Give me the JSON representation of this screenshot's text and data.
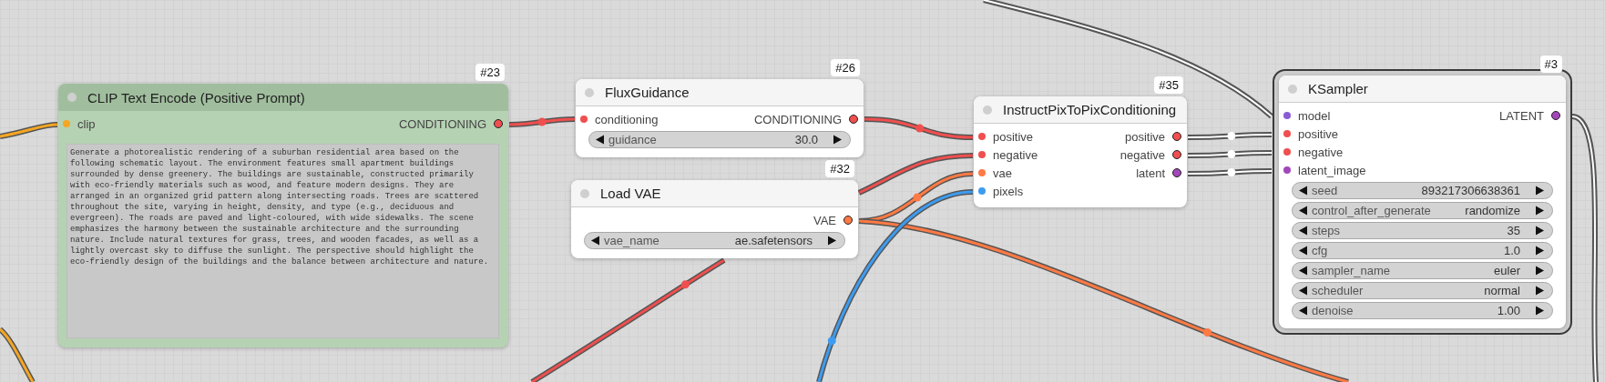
{
  "nodes": [
    {
      "badge": "#23",
      "title": "CLIP Text Encode (Positive Prompt)",
      "color": "#b5d2b3",
      "selected": false,
      "inputs": [
        {
          "label": "clip",
          "color": "#f5a623"
        }
      ],
      "outputs": [
        {
          "label": "CONDITIONING",
          "color": "#ef4f4f"
        }
      ],
      "widgets": [
        {
          "kind": "text",
          "value": "Generate a photorealistic rendering of a suburban residential area based on the following schematic layout. The environment features small apartment buildings surrounded by dense greenery. The buildings are sustainable, constructed primarily with eco-friendly materials such as wood, and feature modern designs. They are arranged in an organized grid pattern along intersecting roads. Trees are scattered throughout the site, varying in height, density, and type (e.g., deciduous and evergreen). The roads are paved and light-coloured, with wide sidewalks. The scene emphasizes the harmony between the sustainable architecture and the surrounding nature. Include natural textures for grass, trees, and wooden facades, as well as a lightly overcast sky to diffuse the sunlight. The perspective should highlight the eco-friendly design of the buildings and the balance between architecture and nature."
        }
      ]
    },
    {
      "badge": "#26",
      "title": "FluxGuidance",
      "selected": false,
      "inputs": [
        {
          "label": "conditioning",
          "color": "#ef4f4f"
        }
      ],
      "outputs": [
        {
          "label": "CONDITIONING",
          "color": "#ef4f4f"
        }
      ],
      "widgets": [
        {
          "kind": "number",
          "label": "guidance",
          "value": "30.0"
        }
      ]
    },
    {
      "badge": "#32",
      "title": "Load VAE",
      "selected": false,
      "outputs": [
        {
          "label": "VAE",
          "color": "#ff7a45"
        }
      ],
      "widgets": [
        {
          "kind": "combo",
          "label": "vae_name",
          "value": "ae.safetensors"
        }
      ]
    },
    {
      "badge": "#35",
      "title": "InstructPixToPixConditioning",
      "selected": false,
      "inputs": [
        {
          "label": "positive",
          "color": "#ef4f4f"
        },
        {
          "label": "negative",
          "color": "#ef4f4f"
        },
        {
          "label": "vae",
          "color": "#ff7a45"
        },
        {
          "label": "pixels",
          "color": "#3d9cf0"
        }
      ],
      "outputs": [
        {
          "label": "positive",
          "color": "#ef4f4f"
        },
        {
          "label": "negative",
          "color": "#ef4f4f"
        },
        {
          "label": "latent",
          "color": "#a347ba"
        }
      ]
    },
    {
      "badge": "#3",
      "title": "KSampler",
      "selected": true,
      "inputs": [
        {
          "label": "model",
          "color": "#8a5cd6"
        },
        {
          "label": "positive",
          "color": "#ef4f4f"
        },
        {
          "label": "negative",
          "color": "#ef4f4f"
        },
        {
          "label": "latent_image",
          "color": "#a347ba"
        }
      ],
      "outputs": [
        {
          "label": "LATENT",
          "color": "#a347ba"
        }
      ],
      "widgets": [
        {
          "kind": "number",
          "label": "seed",
          "value": "893217306638361"
        },
        {
          "kind": "combo",
          "label": "control_after_generate",
          "value": "randomize"
        },
        {
          "kind": "number",
          "label": "steps",
          "value": "35"
        },
        {
          "kind": "number",
          "label": "cfg",
          "value": "1.0"
        },
        {
          "kind": "combo",
          "label": "sampler_name",
          "value": "euler"
        },
        {
          "kind": "combo",
          "label": "scheduler",
          "value": "normal"
        },
        {
          "kind": "number",
          "label": "denoise",
          "value": "1.00"
        }
      ]
    }
  ]
}
